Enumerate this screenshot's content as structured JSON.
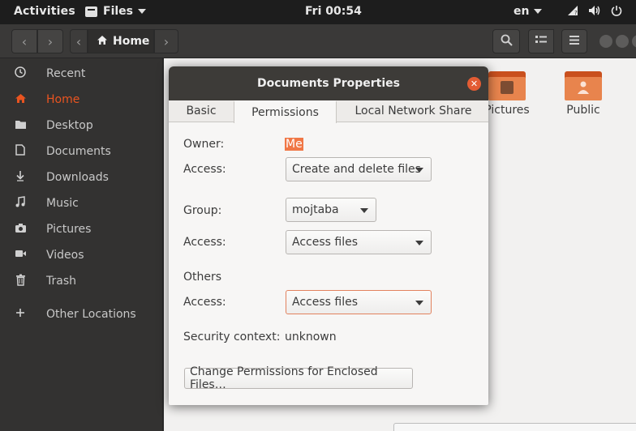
{
  "topbar": {
    "activities": "Activities",
    "app_menu": "Files",
    "clock": "Fri 00:54",
    "language": "en"
  },
  "headerbar": {
    "location": "Home"
  },
  "sidebar": {
    "items": [
      {
        "label": "Recent",
        "icon": "clock-icon"
      },
      {
        "label": "Home",
        "icon": "home-icon",
        "active": true
      },
      {
        "label": "Desktop",
        "icon": "folder-icon"
      },
      {
        "label": "Documents",
        "icon": "document-icon"
      },
      {
        "label": "Downloads",
        "icon": "download-icon"
      },
      {
        "label": "Music",
        "icon": "music-icon"
      },
      {
        "label": "Pictures",
        "icon": "camera-icon"
      },
      {
        "label": "Videos",
        "icon": "video-icon"
      },
      {
        "label": "Trash",
        "icon": "trash-icon"
      },
      {
        "label": "Other Locations",
        "icon": "plus-icon"
      }
    ]
  },
  "content": {
    "folders": [
      {
        "label": "Pictures"
      },
      {
        "label": "Public"
      }
    ]
  },
  "dialog": {
    "title": "Documents Properties",
    "tabs": [
      {
        "label": "Basic"
      },
      {
        "label": "Permissions",
        "selected": true
      },
      {
        "label": "Local Network Share"
      }
    ],
    "owner_label": "Owner:",
    "owner_value": "Me",
    "owner_access_label": "Access:",
    "owner_access_value": "Create and delete files",
    "group_label": "Group:",
    "group_value": "mojtaba",
    "group_access_label": "Access:",
    "group_access_value": "Access files",
    "others_label": "Others",
    "others_access_label": "Access:",
    "others_access_value": "Access files",
    "security_label": "Security context:",
    "security_value": "unknown",
    "enclosed_button": "Change Permissions for Enclosed Files…"
  },
  "colors": {
    "accent": "#e95420",
    "topbar_bg": "#1d1d1d",
    "sidebar_bg": "#333231",
    "content_bg": "#f2f1f0"
  }
}
